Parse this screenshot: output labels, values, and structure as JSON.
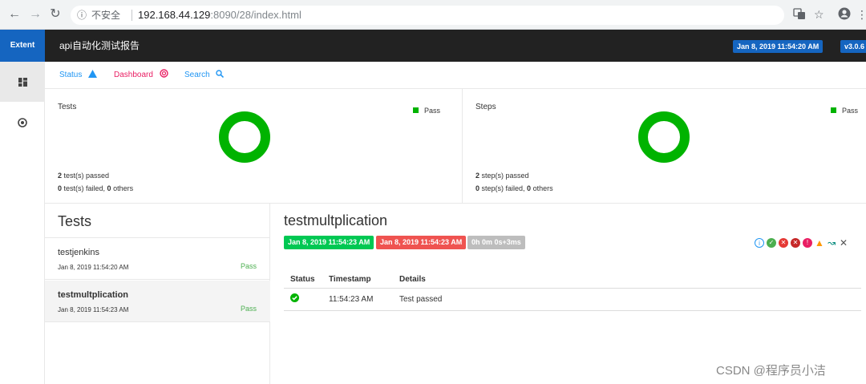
{
  "browser": {
    "info_glyph": "ⓘ",
    "insecure": "不安全",
    "host": "192.168.44.129",
    "path": ":8090/28/index.html"
  },
  "header": {
    "brand": "Extent",
    "report_name": "api自动化测试报告",
    "date": "Jan 8, 2019 11:54:20 AM",
    "version": "v3.0.6"
  },
  "subnav": {
    "status": "Status",
    "dashboard": "Dashboard",
    "search": "Search"
  },
  "dashboard": {
    "tests": {
      "title": "Tests",
      "legend": "Pass",
      "passed_count": "2",
      "passed_text": " test(s) passed",
      "failed_count": "0",
      "failed_text": " test(s) failed, ",
      "others_count": "0",
      "others_text": " others"
    },
    "steps": {
      "title": "Steps",
      "legend": "Pass",
      "passed_count": "2",
      "passed_text": " step(s) passed",
      "failed_count": "0",
      "failed_text": " step(s) failed, ",
      "others_count": "0",
      "others_text": " others"
    }
  },
  "test_list": {
    "title": "Tests",
    "items": [
      {
        "name": "testjenkins",
        "time": "Jan 8, 2019 11:54:20 AM",
        "status": "Pass"
      },
      {
        "name": "testmultplication",
        "time": "Jan 8, 2019 11:54:23 AM",
        "status": "Pass"
      }
    ]
  },
  "detail": {
    "title": "testmultplication",
    "start_time": "Jan 8, 2019 11:54:23 AM",
    "end_time": "Jan 8, 2019 11:54:23 AM",
    "duration": "0h 0m 0s+3ms",
    "columns": [
      "Status",
      "Timestamp",
      "Details"
    ],
    "rows": [
      {
        "status_icon": "check-circle-icon",
        "timestamp": "11:54:23 AM",
        "details": "Test passed"
      }
    ]
  },
  "colors": {
    "pass": "#00b300",
    "brand": "#1565c0",
    "fail": "#e53935",
    "dashboard_link": "#e91e63",
    "link": "#2196f3"
  },
  "watermark": "CSDN @程序员小洁"
}
